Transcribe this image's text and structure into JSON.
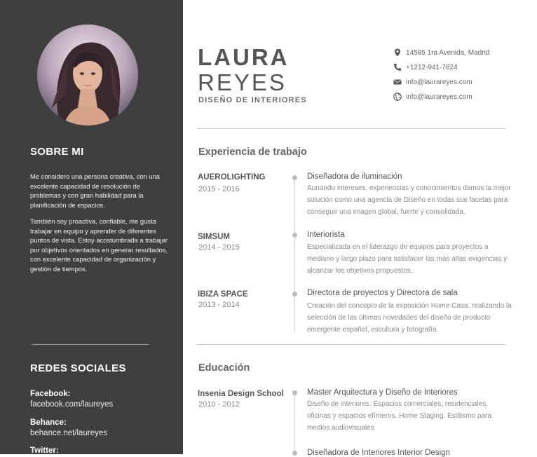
{
  "profile": {
    "first_name": "LAURA",
    "last_name": "REYES",
    "role": "DISEÑO DE INTERIORES"
  },
  "contact": [
    {
      "icon": "map-pin-icon",
      "text": "14585 1ra Avenida, Madrid"
    },
    {
      "icon": "phone-icon",
      "text": "+1212-941-7824"
    },
    {
      "icon": "mail-icon",
      "text": "info@laurareyes.com"
    },
    {
      "icon": "globe-icon",
      "text": "info@laurareyes.com"
    }
  ],
  "sidebar": {
    "about_heading": "SOBRE MI",
    "about_p1": "Me considero una persona creativa, con una excelente capacidad de resolución de problemas y con gran habilidad para la planificación de espacios.",
    "about_p2": " También soy proactiva, confiable, me gusta trabajar en equipo y aprender de diferentes puntos de vista. Estoy acostumbrada a trabajar por objetivos orientados en generar resultados, con excelente capacidad de organización y gestión de tiempos.",
    "social_heading": "REDES SOCIALES",
    "social": [
      {
        "label": "Facebook:",
        "value": "facebook.com/laureyes"
      },
      {
        "label": "Behance:",
        "value": "behance.net/laureyes"
      },
      {
        "label": "Twitter:",
        "value": ""
      }
    ]
  },
  "experience": {
    "title": "Experiencia de trabajo",
    "items": [
      {
        "org": "AUEROLIGHTING",
        "years": "2015 - 2016",
        "position": "Diseñadora de iluminación",
        "desc": "Aunando intereses, experiencias y conocimientos damos la mejor solución como una agencia de Diseño en todas sus facetas para conseguir una imagen global, fuerte y consolidada."
      },
      {
        "org": "SIMSUM",
        "years": "2014 - 2015",
        "position": "Interiorista",
        "desc": "Especializada en el liderazgo de equipos para proyectos a mediano y largo plazo para satisfacer las más altas exigencias y alcanzar los objetivos propuestos."
      },
      {
        "org": "IBIZA SPACE",
        "years": "2013 - 2014",
        "position": "Directora de proyectos y Directora de sala",
        "desc": "Creación del concepto de la exposición Home Casa, realizando la selección de las últimas novedades del diseño de producto emergente español, escultura y fotografía."
      }
    ]
  },
  "education": {
    "title": "Educación",
    "items": [
      {
        "org": "Insenia Design School",
        "years": "2010 - 2012",
        "position": "Master Arquitectura y Diseño de Interiores",
        "desc": "Diseño de interiores. Espacios comerciales, residenciales, oficinas y espacios efímeros. Home Staging. Estilismo para medios audiovisuales"
      },
      {
        "org": "",
        "years": "",
        "position": "Diseñadora de Interiores Interior Design",
        "desc": ""
      }
    ]
  },
  "colors": {
    "sidebar_bg": "#3f3f3f",
    "accent_text": "#555555",
    "timeline": "#cfcfcf"
  }
}
